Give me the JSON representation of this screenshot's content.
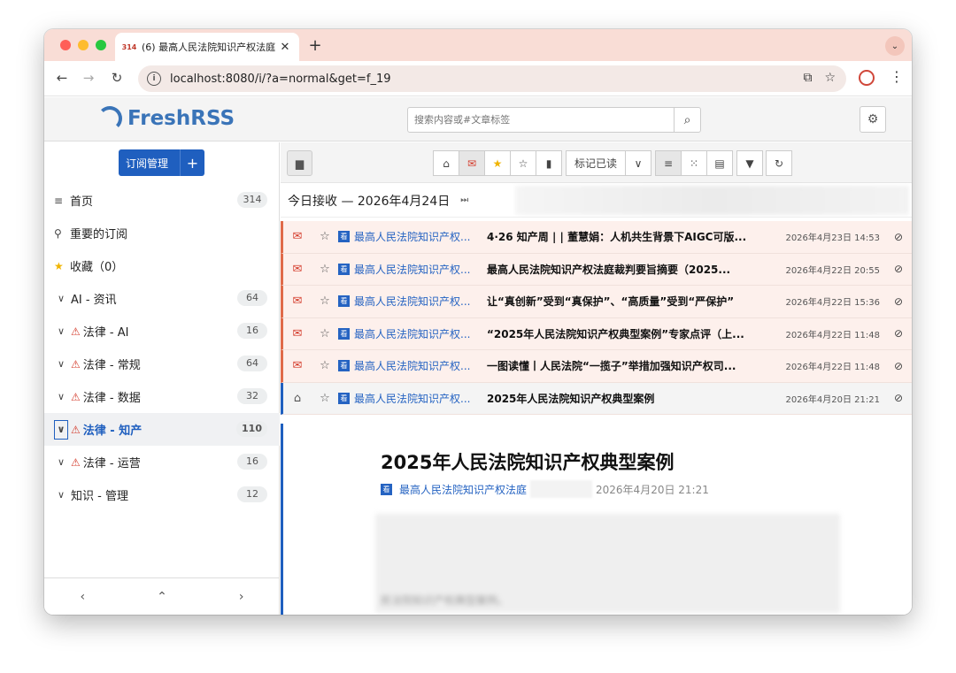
{
  "browser": {
    "tab_title": "(6) 最高人民法院知识产权法庭",
    "tab_badge": "314",
    "new_tab": "+",
    "url": "localhost:8080/i/?a=normal&get=f_19"
  },
  "app": {
    "logo": "FreshRSS",
    "search_placeholder": "搜索内容或#文章标签"
  },
  "sidebar": {
    "manage_button": "订阅管理",
    "add_button": "+",
    "items": [
      {
        "label": "首页",
        "count": "314",
        "type": "home"
      },
      {
        "label": "重要的订阅",
        "count": "",
        "type": "important"
      },
      {
        "label": "收藏（0）",
        "count": "",
        "type": "favorites"
      },
      {
        "label": "AI - 资讯",
        "count": "64",
        "type": "category",
        "warn": false
      },
      {
        "label": "法律 - AI",
        "count": "16",
        "type": "category",
        "warn": true
      },
      {
        "label": "法律 - 常规",
        "count": "64",
        "type": "category",
        "warn": true
      },
      {
        "label": "法律 - 数据",
        "count": "32",
        "type": "category",
        "warn": true
      },
      {
        "label": "法律 - 知产",
        "count": "110",
        "type": "category",
        "warn": true,
        "active": true
      },
      {
        "label": "法律 - 运营",
        "count": "16",
        "type": "category",
        "warn": true
      },
      {
        "label": "知识 - 管理",
        "count": "12",
        "type": "category",
        "warn": false
      }
    ]
  },
  "main": {
    "mark_read": "标记已读",
    "date_header": "今日接收 — 2026年4月24日",
    "rows": [
      {
        "source": "最高人民法院知识产权...",
        "title": "4·26 知产周 | | 董慧娟：人机共生背景下AIGC可版...",
        "date": "2026年4月23日 14:53",
        "state": "unread"
      },
      {
        "source": "最高人民法院知识产权...",
        "title": "最高人民法院知识产权法庭裁判要旨摘要（2025...",
        "date": "2026年4月22日 20:55",
        "state": "unread"
      },
      {
        "source": "最高人民法院知识产权...",
        "title": "让“真创新”受到“真保护”、“高质量”受到“严保护”",
        "date": "2026年4月22日 15:36",
        "state": "unread"
      },
      {
        "source": "最高人民法院知识产权...",
        "title": "“2025年人民法院知识产权典型案例”专家点评（上...",
        "date": "2026年4月22日 11:48",
        "state": "unread"
      },
      {
        "source": "最高人民法院知识产权...",
        "title": "一图读懂丨人民法院“一揽子”举措加强知识产权司...",
        "date": "2026年4月22日 11:48",
        "state": "unread"
      },
      {
        "source": "最高人民法院知识产权...",
        "title": "2025年人民法院知识产权典型案例",
        "date": "2026年4月20日 21:21",
        "state": "read"
      }
    ],
    "article": {
      "title": "2025年人民法院知识产权典型案例",
      "source": "最高人民法院知识产权法庭",
      "date": "2026年4月20日 21:21",
      "teaser": "民法院知识产权典型案例。"
    }
  }
}
